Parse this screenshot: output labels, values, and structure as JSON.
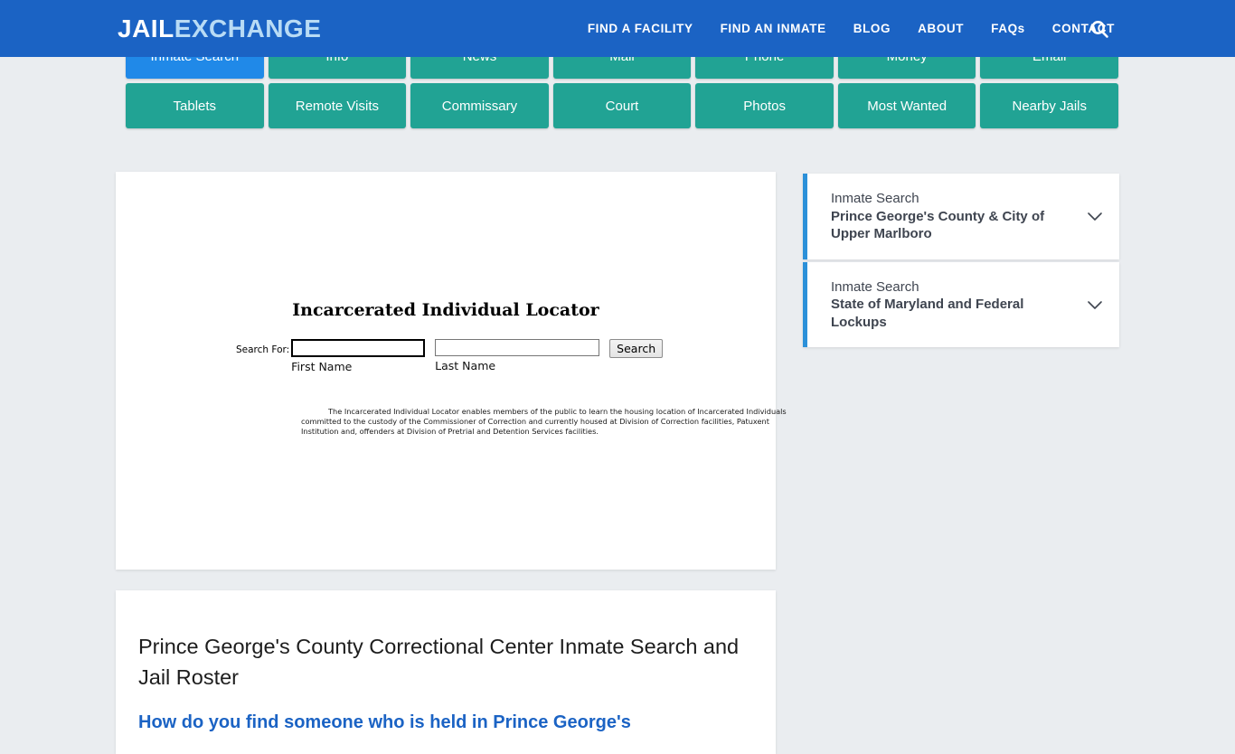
{
  "header": {
    "logo_part1": "JAIL",
    "logo_part2": "EXCHANGE",
    "brand_color": "#1b63c4",
    "nav": [
      {
        "label": "FIND A FACILITY"
      },
      {
        "label": "FIND AN INMATE"
      },
      {
        "label": "BLOG"
      },
      {
        "label": "ABOUT"
      },
      {
        "label": "FAQs"
      },
      {
        "label": "CONTACT"
      }
    ],
    "search_icon": "search-icon"
  },
  "tabs": {
    "active_color": "#2089e8",
    "inactive_color": "#21a394",
    "row1": [
      {
        "label": "Inmate Search",
        "active": true
      },
      {
        "label": "Info",
        "active": false
      },
      {
        "label": "News",
        "active": false
      },
      {
        "label": "Mail",
        "active": false
      },
      {
        "label": "Phone",
        "active": false
      },
      {
        "label": "Money",
        "active": false
      },
      {
        "label": "Email",
        "active": false
      }
    ],
    "row2": [
      {
        "label": "Tablets",
        "active": false
      },
      {
        "label": "Remote Visits",
        "active": false
      },
      {
        "label": "Commissary",
        "active": false
      },
      {
        "label": "Court",
        "active": false
      },
      {
        "label": "Photos",
        "active": false
      },
      {
        "label": "Most Wanted",
        "active": false
      },
      {
        "label": "Nearby Jails",
        "active": false
      }
    ]
  },
  "locator": {
    "title": "Incarcerated Individual Locator",
    "search_for_label": "Search For:",
    "first_name_value": "",
    "first_name_caption": "First Name",
    "last_name_value": "",
    "last_name_caption": "Last Name",
    "search_button": "Search",
    "description": "The Incarcerated Individual Locator enables members of the public to learn the housing location of Incarcerated Individuals committed to the custody of the Commissioner of Correction and currently housed at Division of Correction facilities, Patuxent Institution and, offenders at Division of Pretrial and Detention Services facilities."
  },
  "article": {
    "title": "Prince George's County Correctional Center Inmate Search and Jail Roster",
    "subtitle": "How do you find someone who is held in Prince George's"
  },
  "sidebar": {
    "accent_color": "#2b90d9",
    "items": [
      {
        "line1": "Inmate Search",
        "line2": "Prince George's County & City of Upper Marlboro",
        "chevron": "chevron-down-icon"
      },
      {
        "line1": "Inmate Search",
        "line2": "State of Maryland and Federal Lockups",
        "chevron": "chevron-down-icon"
      }
    ]
  }
}
